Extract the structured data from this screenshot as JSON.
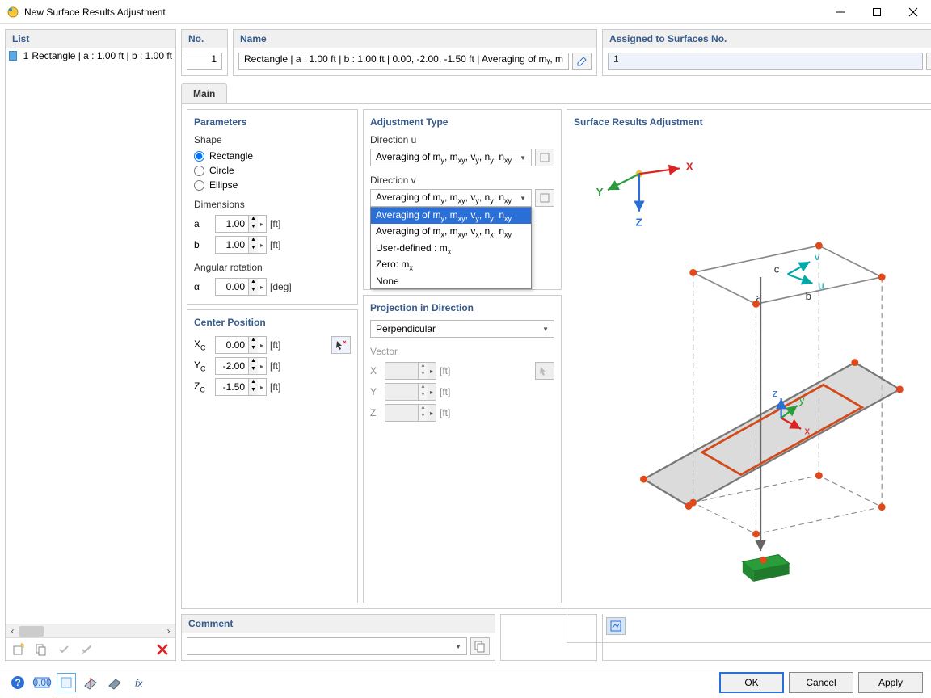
{
  "window": {
    "title": "New Surface Results Adjustment"
  },
  "left": {
    "header": "List",
    "row": {
      "num": "1",
      "text": "Rectangle | a : 1.00 ft | b : 1.00 ft"
    }
  },
  "top": {
    "no_label": "No.",
    "no_value": "1",
    "name_label": "Name",
    "name_value": "Rectangle | a : 1.00 ft | b : 1.00 ft | 0.00, -2.00, -1.50 ft | Averaging of mᵧ, m",
    "assigned_label": "Assigned to Surfaces No.",
    "assigned_value": "1"
  },
  "tab": {
    "main": "Main"
  },
  "params": {
    "header": "Parameters",
    "shape_label": "Shape",
    "rectangle": "Rectangle",
    "circle": "Circle",
    "ellipse": "Ellipse",
    "dim_label": "Dimensions",
    "a_label": "a",
    "a_val": "1.00",
    "a_unit": "[ft]",
    "b_label": "b",
    "b_val": "1.00",
    "b_unit": "[ft]",
    "rot_label": "Angular rotation",
    "alpha_label": "α",
    "alpha_val": "0.00",
    "alpha_unit": "[deg]"
  },
  "center": {
    "header": "Center Position",
    "xc_label": "Xc",
    "xc_val": "0.00",
    "xc_unit": "[ft]",
    "yc_label": "Yc",
    "yc_val": "-2.00",
    "yc_unit": "[ft]",
    "zc_label": "Zc",
    "zc_val": "-1.50",
    "zc_unit": "[ft]"
  },
  "adj": {
    "header": "Adjustment Type",
    "diru_label": "Direction u",
    "diru_value": "Averaging of mᵧ, mₓᵧ, vᵧ, nᵧ, nₓᵧ",
    "dirv_label": "Direction v",
    "dirv_value": "Averaging of mᵧ, mₓᵧ, vᵧ, nᵧ, nₓᵧ",
    "options": [
      "Averaging of mᵧ, mₓᵧ, vᵧ, nᵧ, nₓᵧ",
      "Averaging of mₓ, mₓᵧ, vₓ, nₓ, nₓᵧ",
      "User-defined : mₓ",
      "Zero: mₓ",
      "None"
    ]
  },
  "proj": {
    "header": "Projection in Direction",
    "value": "Perpendicular",
    "vector_label": "Vector",
    "x_label": "X",
    "y_label": "Y",
    "z_label": "Z",
    "unit": "[ft]"
  },
  "preview": {
    "header": "Surface Results Adjustment",
    "axis_x": "X",
    "axis_y": "Y",
    "axis_z": "Z",
    "lbl_a": "a",
    "lbl_b": "b",
    "lbl_c": "c",
    "lbl_u": "u",
    "lbl_v": "v",
    "lbl_lx": "x",
    "lbl_ly": "y",
    "lbl_lz": "z"
  },
  "comment": {
    "header": "Comment",
    "value": ""
  },
  "buttons": {
    "ok": "OK",
    "cancel": "Cancel",
    "apply": "Apply"
  }
}
